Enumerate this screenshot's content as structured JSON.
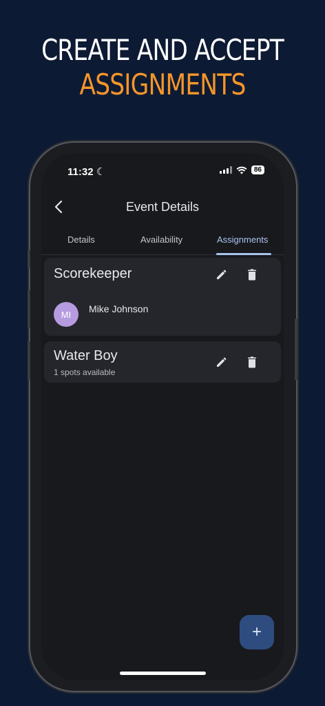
{
  "headline": {
    "line1": "CREATE AND ACCEPT",
    "line2": "ASSIGNMENTS"
  },
  "status_bar": {
    "time": "11:32",
    "battery": "86"
  },
  "header": {
    "title": "Event Details",
    "back_icon": "chevron-left-icon"
  },
  "tabs": [
    {
      "label": "Details",
      "active": false
    },
    {
      "label": "Availability",
      "active": false
    },
    {
      "label": "Assignments",
      "active": true
    }
  ],
  "assignments": [
    {
      "title": "Scorekeeper",
      "assignees": [
        {
          "initials": "MI",
          "name": "Mike Johnson"
        }
      ]
    },
    {
      "title": "Water Boy",
      "subtitle": "1 spots available"
    }
  ],
  "fab": {
    "label": "+"
  },
  "colors": {
    "accent": "#f4952b",
    "tab_active": "#a9c3ee",
    "avatar": "#b69be0",
    "fab": "#2e4c7f"
  }
}
